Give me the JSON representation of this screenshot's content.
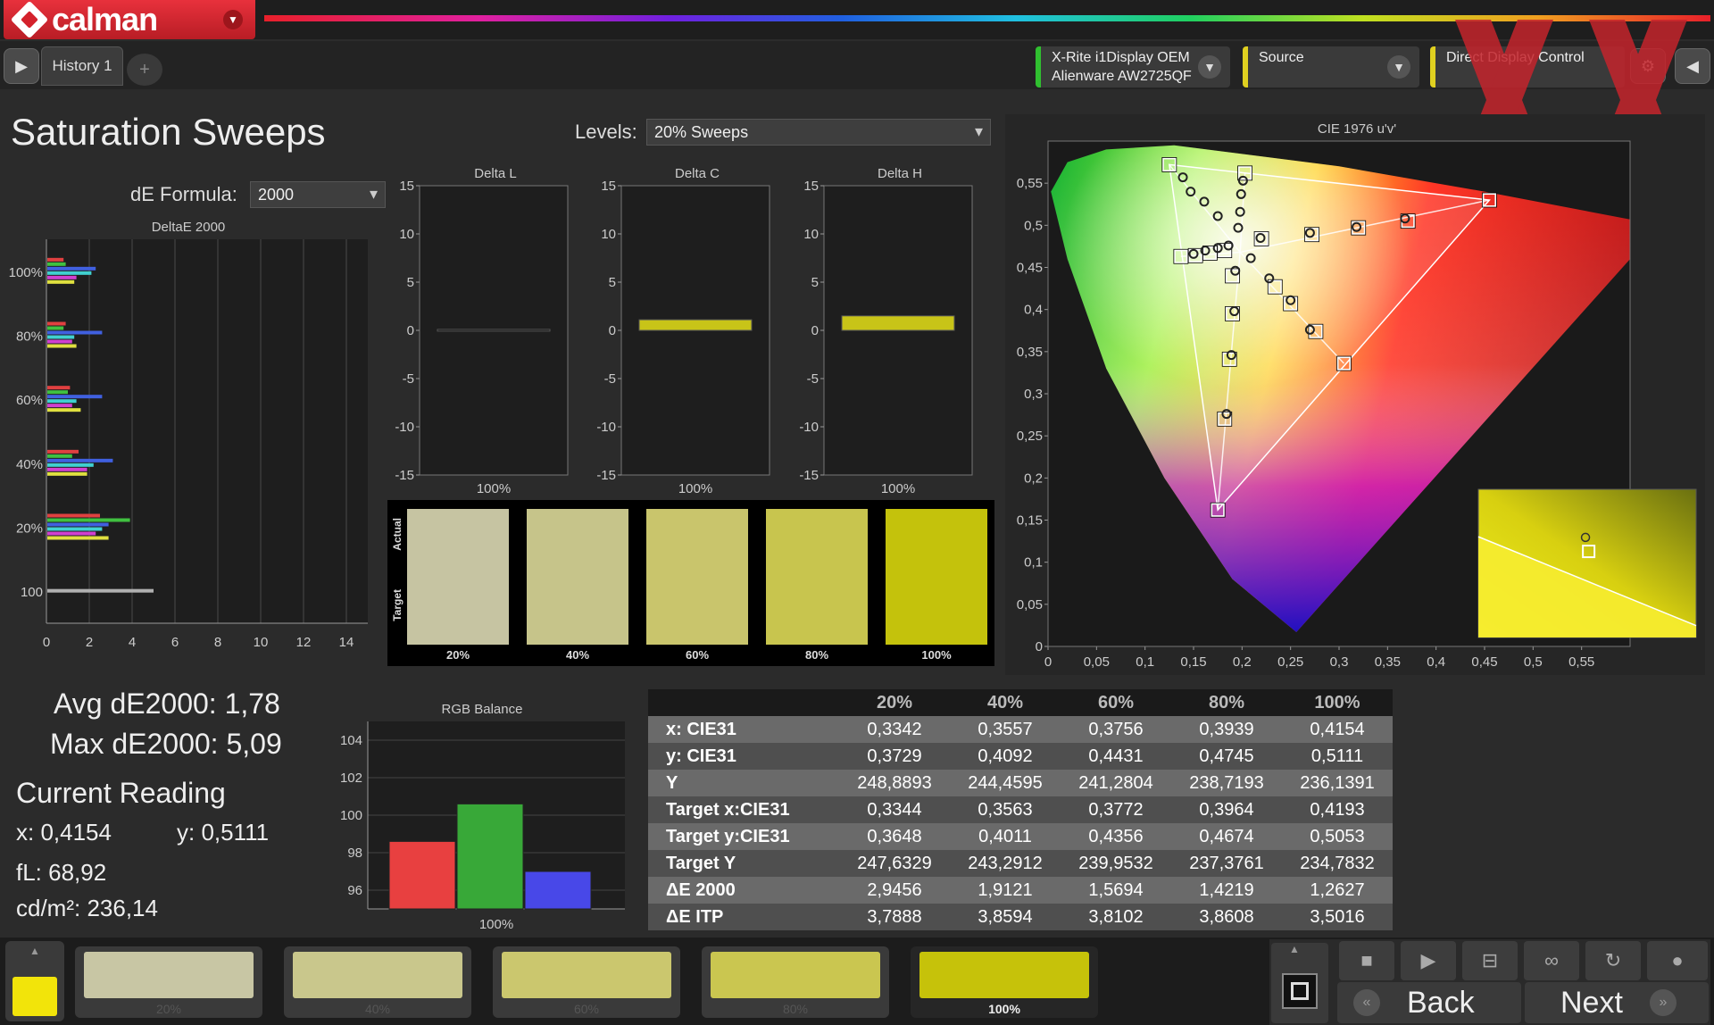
{
  "app": {
    "name": "calman"
  },
  "tabs": {
    "history": "History 1",
    "add": "+"
  },
  "devices": {
    "meter_line1": "X-Rite i1Display OEM",
    "meter_line2": "Alienware AW2725QF",
    "source": "Source",
    "display": "Direct Display Control"
  },
  "page": {
    "title": "Saturation Sweeps",
    "levels_label": "Levels:",
    "levels_value": "20% Sweeps",
    "de_formula_label": "dE Formula:",
    "de_formula_value": "2000"
  },
  "summary": {
    "avg": "Avg dE2000: 1,78",
    "max": "Max dE2000: 5,09",
    "current_reading": "Current Reading",
    "x": "x: 0,4154",
    "y": "y: 0,5111",
    "fl": "fL: 68,92",
    "cdm": "cd/m²: 236,14"
  },
  "swatches": {
    "actual_label": "Actual",
    "target_label": "Target",
    "items": [
      {
        "label": "20%",
        "color": "#c6c4a2"
      },
      {
        "label": "40%",
        "color": "#c6c48a"
      },
      {
        "label": "60%",
        "color": "#c9c56c"
      },
      {
        "label": "80%",
        "color": "#c8c54e"
      },
      {
        "label": "100%",
        "color": "#c4c20c"
      }
    ]
  },
  "table": {
    "headers": [
      "",
      "20%",
      "40%",
      "60%",
      "80%",
      "100%"
    ],
    "rows": [
      {
        "label": "x: CIE31",
        "values": [
          "0,3342",
          "0,3557",
          "0,3756",
          "0,3939",
          "0,4154"
        ]
      },
      {
        "label": "y: CIE31",
        "values": [
          "0,3729",
          "0,4092",
          "0,4431",
          "0,4745",
          "0,5111"
        ]
      },
      {
        "label": "Y",
        "values": [
          "248,8893",
          "244,4595",
          "241,2804",
          "238,7193",
          "236,1391"
        ]
      },
      {
        "label": "Target x:CIE31",
        "values": [
          "0,3344",
          "0,3563",
          "0,3772",
          "0,3964",
          "0,4193"
        ]
      },
      {
        "label": "Target y:CIE31",
        "values": [
          "0,3648",
          "0,4011",
          "0,4356",
          "0,4674",
          "0,5053"
        ]
      },
      {
        "label": "Target Y",
        "values": [
          "247,6329",
          "243,2912",
          "239,9532",
          "237,3761",
          "234,7832"
        ]
      },
      {
        "label": "ΔE 2000",
        "values": [
          "2,9456",
          "1,9121",
          "1,5694",
          "1,4219",
          "1,2627"
        ]
      },
      {
        "label": "ΔE ITP",
        "values": [
          "3,7888",
          "3,8594",
          "3,8102",
          "3,8608",
          "3,5016"
        ]
      }
    ]
  },
  "bottom": {
    "current_color": "#f2e40a",
    "swatches": [
      {
        "label": "20%",
        "color": "#c8c6a4"
      },
      {
        "label": "40%",
        "color": "#c9c78c"
      },
      {
        "label": "60%",
        "color": "#cbc76e"
      },
      {
        "label": "80%",
        "color": "#cac650"
      },
      {
        "label": "100%",
        "color": "#c6c20a"
      }
    ],
    "back": "Back",
    "next": "Next"
  },
  "chart_data": [
    {
      "type": "bar",
      "title": "DeltaE 2000",
      "orientation": "horizontal",
      "categories": [
        "100",
        "20%",
        "40%",
        "60%",
        "80%",
        "100%"
      ],
      "xticks": [
        "0",
        "2",
        "4",
        "6",
        "8",
        "10",
        "12",
        "14"
      ],
      "xlim": [
        0,
        15
      ],
      "series_colors": [
        "#e04040",
        "#40c040",
        "#4060e0",
        "#40d0d0",
        "#d040d0",
        "#e0e040",
        "#b0b0b0"
      ],
      "groups": [
        {
          "category": "100",
          "values": [
            5.0
          ]
        },
        {
          "category": "20%",
          "values": [
            2.5,
            3.9,
            2.9,
            2.6,
            2.3,
            2.9
          ]
        },
        {
          "category": "40%",
          "values": [
            1.5,
            1.2,
            3.1,
            2.2,
            1.9,
            1.9
          ]
        },
        {
          "category": "60%",
          "values": [
            1.1,
            1.0,
            2.6,
            1.4,
            1.2,
            1.6
          ]
        },
        {
          "category": "80%",
          "values": [
            0.9,
            0.8,
            2.6,
            1.3,
            1.2,
            1.4
          ]
        },
        {
          "category": "100%",
          "values": [
            0.8,
            0.9,
            2.3,
            2.1,
            1.4,
            1.3
          ]
        }
      ]
    },
    {
      "type": "bar",
      "title": "Delta L",
      "categories": [
        "100%"
      ],
      "values": [
        0.1
      ],
      "yticks": [
        "15",
        "10",
        "5",
        "0",
        "-5",
        "-10",
        "-15"
      ],
      "ylim": [
        -15,
        15
      ]
    },
    {
      "type": "bar",
      "title": "Delta C",
      "categories": [
        "100%"
      ],
      "values": [
        1.1
      ],
      "yticks": [
        "15",
        "10",
        "5",
        "0",
        "-5",
        "-10",
        "-15"
      ],
      "ylim": [
        -15,
        15
      ]
    },
    {
      "type": "bar",
      "title": "Delta H",
      "categories": [
        "100%"
      ],
      "values": [
        1.5
      ],
      "yticks": [
        "15",
        "10",
        "5",
        "0",
        "-5",
        "-10",
        "-15"
      ],
      "ylim": [
        -15,
        15
      ]
    },
    {
      "type": "bar",
      "title": "RGB Balance",
      "categories": [
        "100%"
      ],
      "series": [
        {
          "color": "#e84040",
          "values": [
            98.6
          ]
        },
        {
          "color": "#38a838",
          "values": [
            100.6
          ]
        },
        {
          "color": "#4848e8",
          "values": [
            97.0
          ]
        }
      ],
      "yticks": [
        "104",
        "102",
        "100",
        "98",
        "96"
      ],
      "ylim": [
        95,
        105
      ]
    },
    {
      "type": "scatter",
      "title": "CIE 1976 u'v'",
      "xticks": [
        "0",
        "0,05",
        "0,1",
        "0,15",
        "0,2",
        "0,25",
        "0,3",
        "0,35",
        "0,4",
        "0,45",
        "0,5",
        "0,55"
      ],
      "yticks": [
        "0",
        "0,05",
        "0,1",
        "0,15",
        "0,2",
        "0,25",
        "0,3",
        "0,35",
        "0,4",
        "0,45",
        "0,5",
        "0,55"
      ],
      "xlim": [
        0,
        0.6
      ],
      "ylim": [
        0,
        0.6
      ],
      "white_point": [
        0.198,
        0.468
      ],
      "targets": [
        [
          0.125,
          0.572
        ],
        [
          0.203,
          0.562
        ],
        [
          0.455,
          0.53
        ],
        [
          0.175,
          0.162
        ],
        [
          0.305,
          0.336
        ],
        [
          0.137,
          0.463
        ],
        [
          0.152,
          0.464
        ],
        [
          0.167,
          0.467
        ],
        [
          0.182,
          0.47
        ],
        [
          0.19,
          0.44
        ],
        [
          0.19,
          0.395
        ],
        [
          0.187,
          0.341
        ],
        [
          0.182,
          0.27
        ],
        [
          0.22,
          0.484
        ],
        [
          0.272,
          0.489
        ],
        [
          0.32,
          0.497
        ],
        [
          0.371,
          0.505
        ],
        [
          0.234,
          0.427
        ],
        [
          0.25,
          0.407
        ],
        [
          0.276,
          0.374
        ]
      ],
      "measured": [
        [
          0.139,
          0.557
        ],
        [
          0.147,
          0.54
        ],
        [
          0.161,
          0.528
        ],
        [
          0.175,
          0.511
        ],
        [
          0.201,
          0.553
        ],
        [
          0.199,
          0.537
        ],
        [
          0.198,
          0.516
        ],
        [
          0.196,
          0.497
        ],
        [
          0.15,
          0.466
        ],
        [
          0.162,
          0.47
        ],
        [
          0.175,
          0.473
        ],
        [
          0.186,
          0.476
        ],
        [
          0.193,
          0.446
        ],
        [
          0.192,
          0.398
        ],
        [
          0.189,
          0.346
        ],
        [
          0.184,
          0.276
        ],
        [
          0.219,
          0.485
        ],
        [
          0.27,
          0.491
        ],
        [
          0.318,
          0.498
        ],
        [
          0.368,
          0.508
        ],
        [
          0.209,
          0.461
        ],
        [
          0.228,
          0.437
        ],
        [
          0.25,
          0.411
        ],
        [
          0.27,
          0.376
        ],
        [
          0.492,
          0.128
        ]
      ]
    }
  ]
}
